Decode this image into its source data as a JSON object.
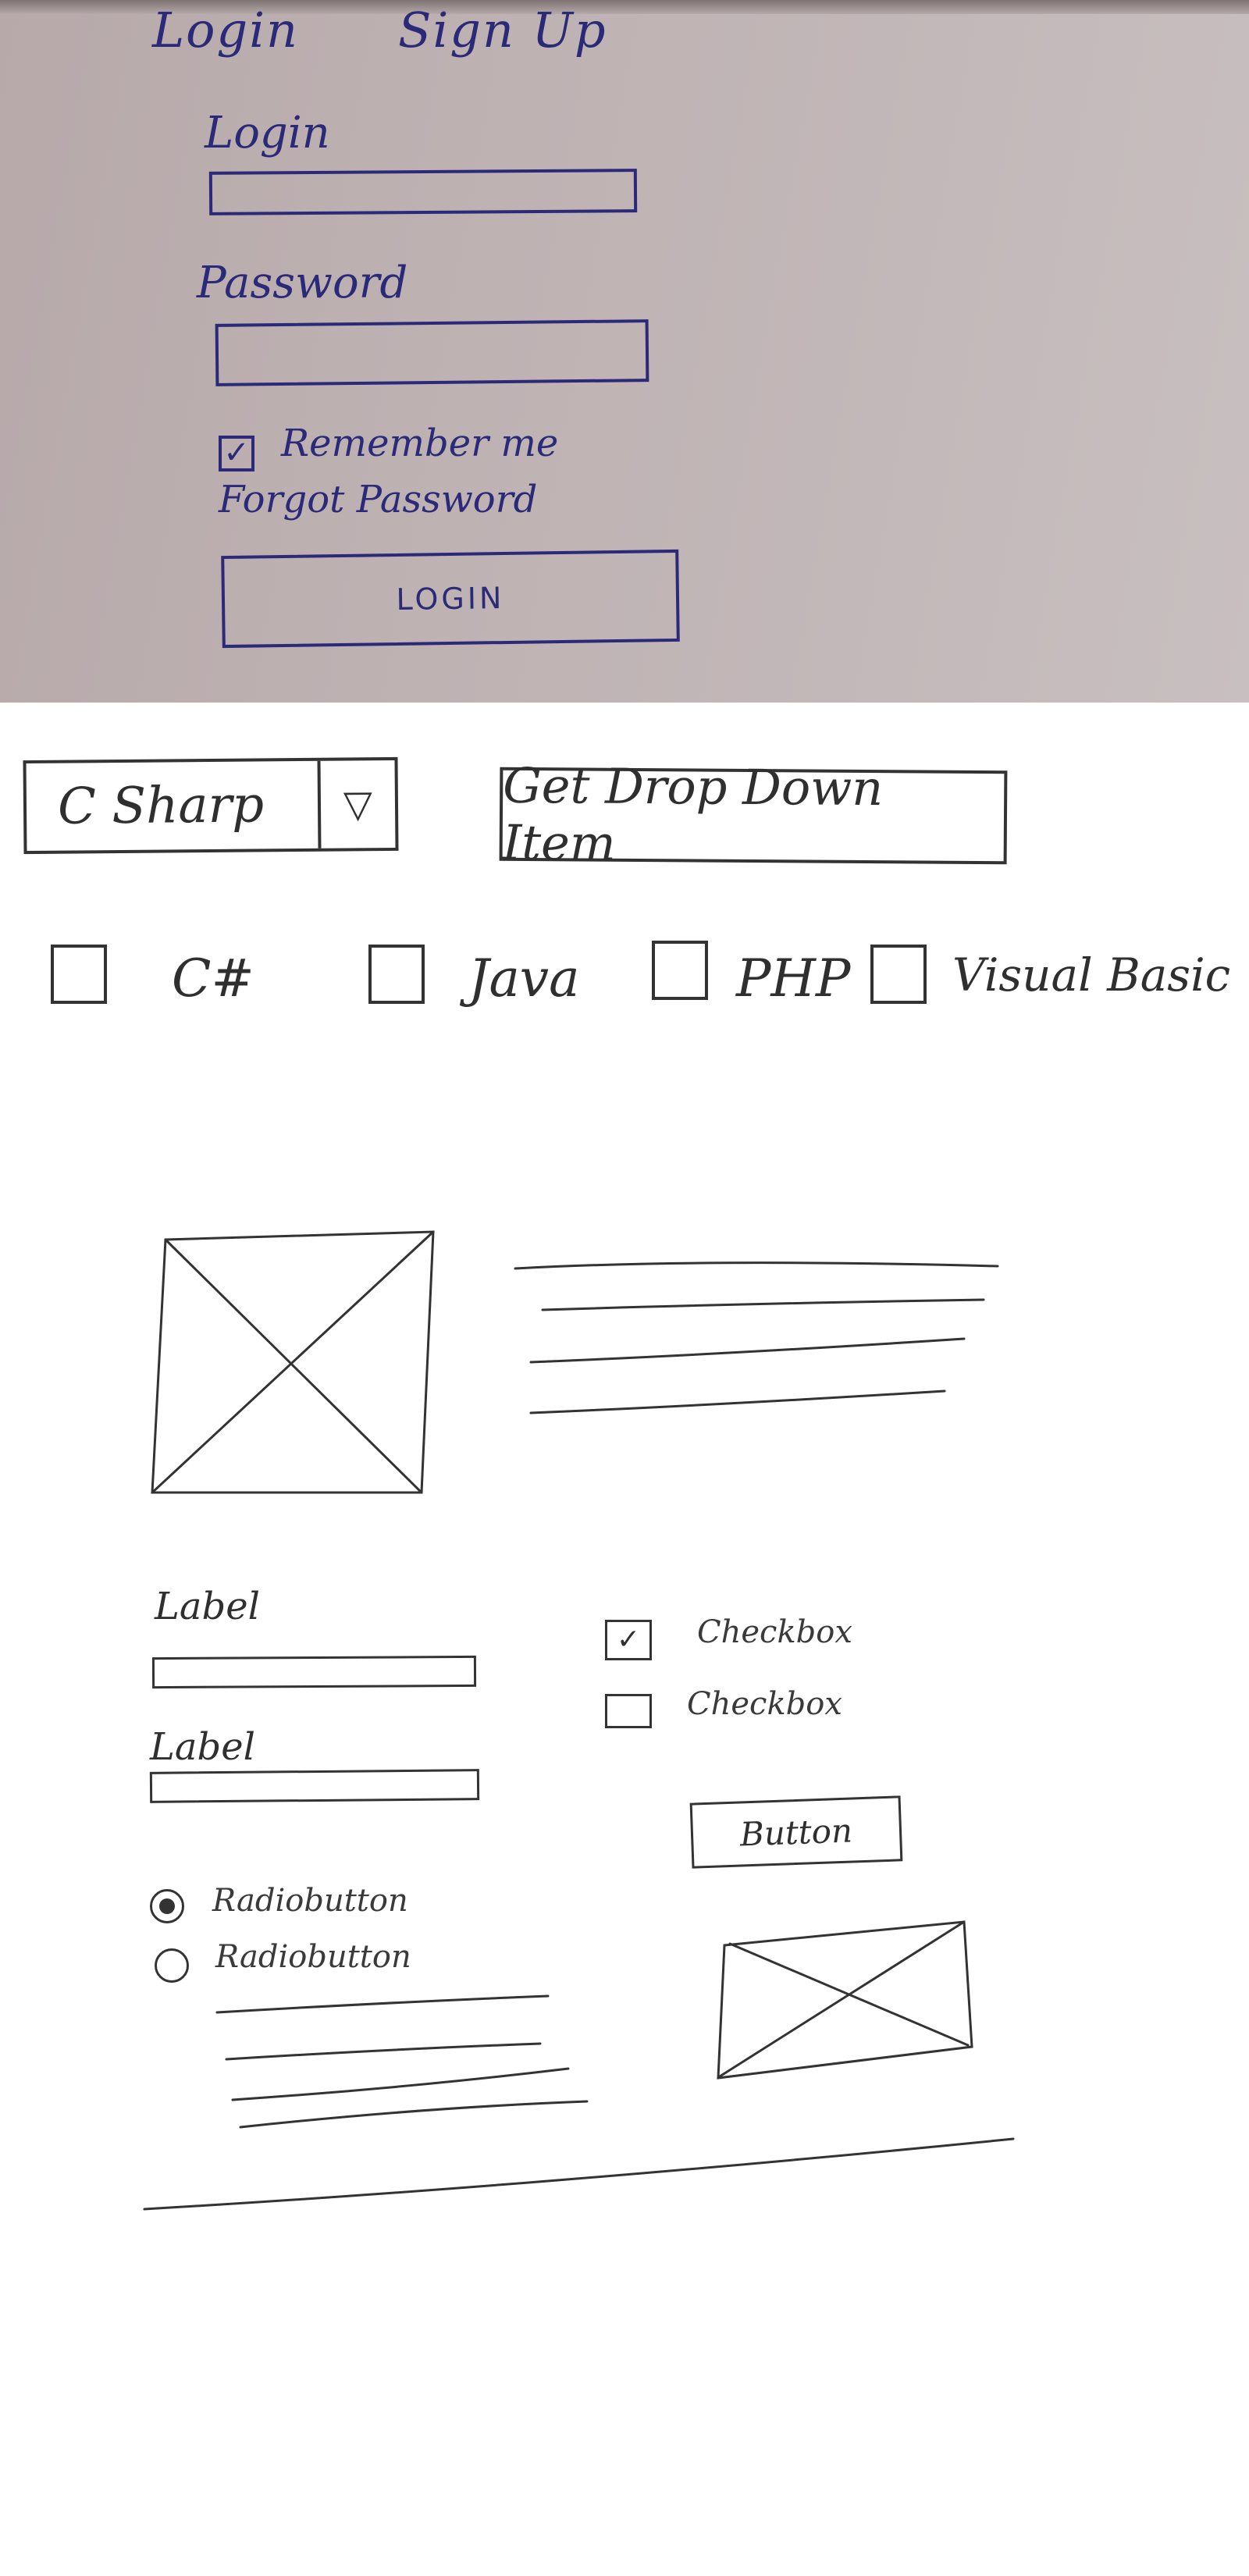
{
  "login_sketch": {
    "tabs": [
      "Login",
      "Sign Up"
    ],
    "login_label": "Login",
    "login_value": "",
    "password_label": "Password",
    "password_value": "",
    "remember_label": "Remember me",
    "remember_checked": true,
    "forgot_link": "Forgot Password",
    "login_button": "LOGIN"
  },
  "dropdown": {
    "selected": "C Sharp",
    "arrow_icon": "dropdown-arrow-icon",
    "get_button": "Get Drop Down Item"
  },
  "language_options": [
    {
      "label": "C#",
      "checked": false
    },
    {
      "label": "Java",
      "checked": false
    },
    {
      "label": "PHP",
      "checked": false
    },
    {
      "label": "Visual Basic",
      "checked": false
    }
  ],
  "form": {
    "label_1": "Label",
    "label_2": "Label",
    "checkbox_1": "Checkbox",
    "checkbox_1_checked": true,
    "checkbox_2": "Checkbox",
    "checkbox_2_checked": false,
    "button": "Button",
    "radio_1": "Radiobutton",
    "radio_1_selected": true,
    "radio_2": "Radiobutton",
    "radio_2_selected": false
  },
  "icons": {
    "image_placeholder": "image-placeholder-icon",
    "check": "check-icon"
  },
  "colors": {
    "photo_ink": "#2a2a78",
    "pencil": "#333333",
    "photo_paper": "#c2b7b8"
  }
}
